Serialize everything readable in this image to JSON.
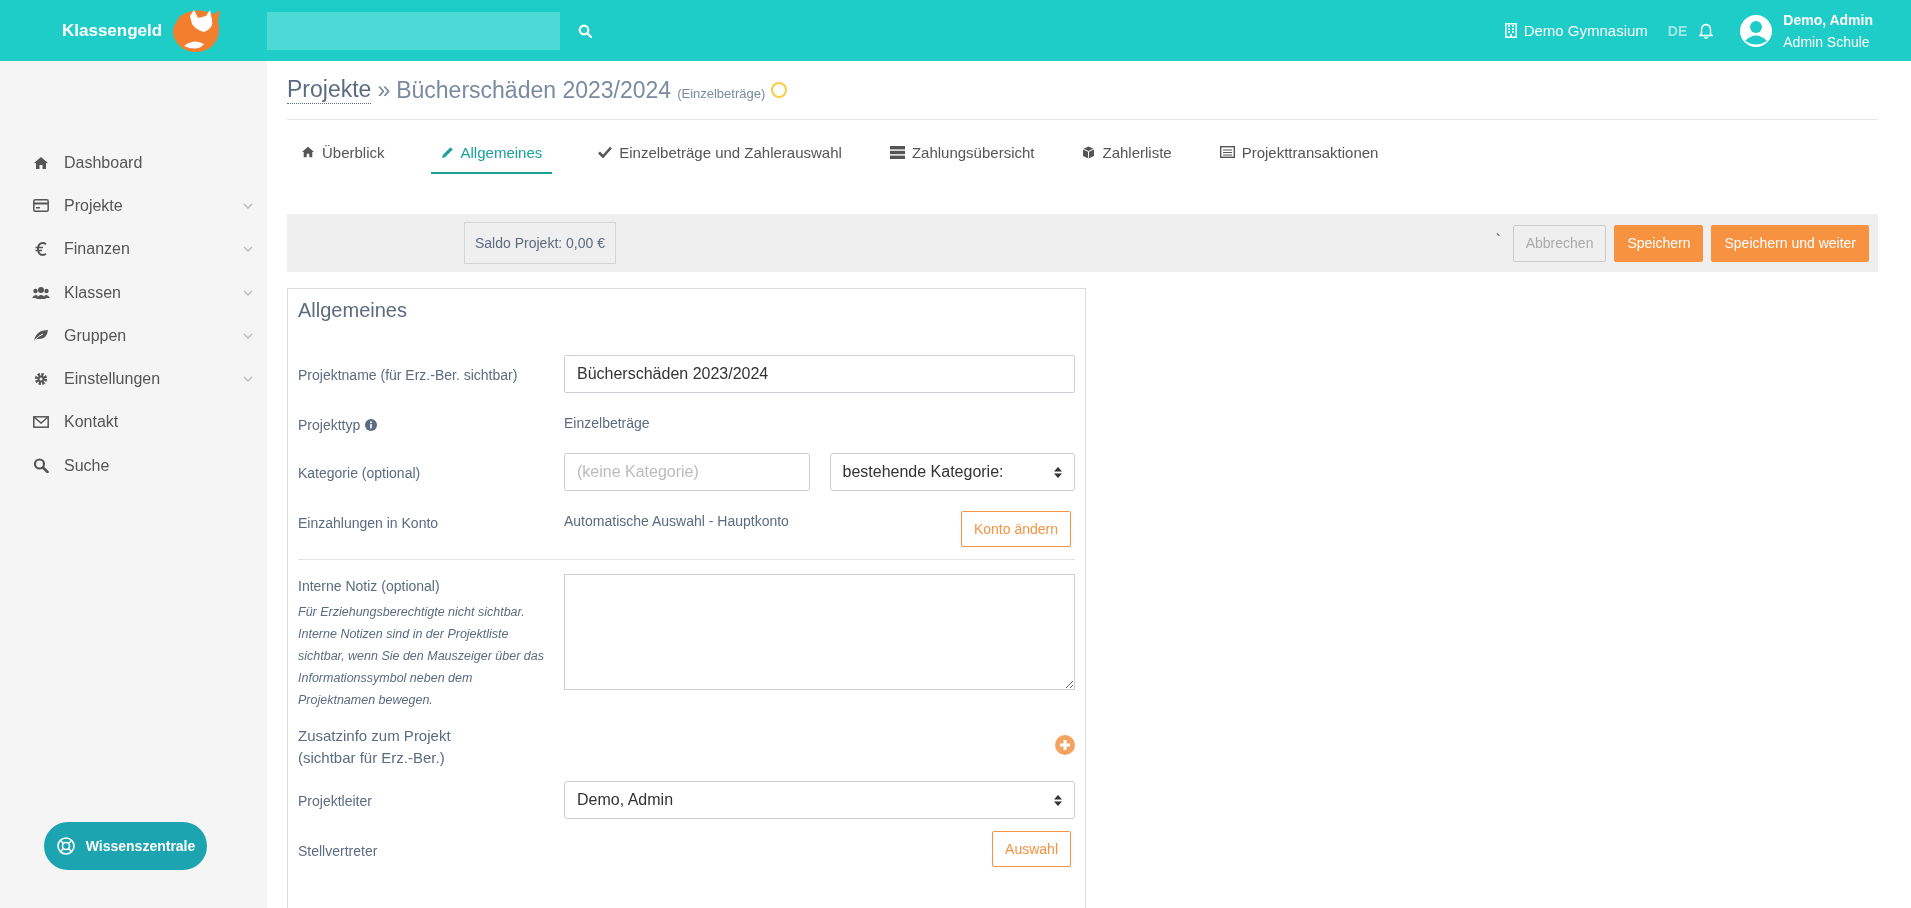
{
  "header": {
    "brand": "Klassengeld",
    "school": "Demo Gymnasium",
    "language": "DE",
    "user": {
      "name": "Demo, Admin",
      "role": "Admin Schule"
    }
  },
  "sidebar": {
    "items": [
      {
        "label": "Dashboard",
        "expandable": false
      },
      {
        "label": "Projekte",
        "expandable": true
      },
      {
        "label": "Finanzen",
        "expandable": true
      },
      {
        "label": "Klassen",
        "expandable": true
      },
      {
        "label": "Gruppen",
        "expandable": true
      },
      {
        "label": "Einstellungen",
        "expandable": true
      },
      {
        "label": "Kontakt",
        "expandable": false
      },
      {
        "label": "Suche",
        "expandable": false
      }
    ],
    "help_button": "Wissenszentrale"
  },
  "breadcrumb": {
    "parent": "Projekte",
    "separator": "»",
    "current": "Bücherschäden 2023/2024",
    "type": "(Einzelbeträge)"
  },
  "tabs": [
    {
      "label": "Überblick",
      "selected": false
    },
    {
      "label": "Allgemeines",
      "selected": true
    },
    {
      "label": "Einzelbeträge und Zahlerauswahl",
      "selected": false
    },
    {
      "label": "Zahlungsübersicht",
      "selected": false
    },
    {
      "label": "Zahlerliste",
      "selected": false
    },
    {
      "label": "Projekttransaktionen",
      "selected": false
    }
  ],
  "action_bar": {
    "balance": "Saldo Projekt: 0,00 €",
    "mark": "`",
    "buttons": [
      {
        "label": "Abbrechen",
        "kind": "outline"
      },
      {
        "label": "Speichern",
        "kind": "primary"
      },
      {
        "label": "Speichern und weiter",
        "kind": "primary"
      }
    ]
  },
  "form": {
    "title": "Allgemeines",
    "fields": [
      {
        "kind": "input",
        "label": "Projektname (für Erz.-Ber. sichtbar)",
        "value": "Bücherschäden 2023/2024"
      },
      {
        "kind": "static",
        "label": "Projekttyp",
        "info": true,
        "value": "Einzelbeträge"
      },
      {
        "kind": "category",
        "label": "Kategorie (optional)",
        "placeholder": "(keine Kategorie)",
        "select": "bestehende Kategorie:"
      },
      {
        "kind": "account",
        "label": "Einzahlungen in Konto",
        "value": "Automatische Auswahl - Hauptkonto",
        "button": "Konto ändern"
      },
      {
        "kind": "divider"
      },
      {
        "kind": "textarea",
        "label": "Interne Notiz (optional)",
        "hint": "Für Erziehungsberechtigte nicht sichtbar. Interne Notizen sind in der Projektliste sichtbar, wenn Sie den Mauszeiger über das Informationssymbol neben dem Projektnamen bewegen."
      },
      {
        "kind": "add",
        "label": "Zusatzinfo zum Projekt (sichtbar für Erz.-Ber.)"
      },
      {
        "kind": "select",
        "label": "Projektleiter",
        "value": "Demo, Admin"
      },
      {
        "kind": "pick",
        "label": "Stellvertreter",
        "button": "Auswahl"
      }
    ]
  }
}
